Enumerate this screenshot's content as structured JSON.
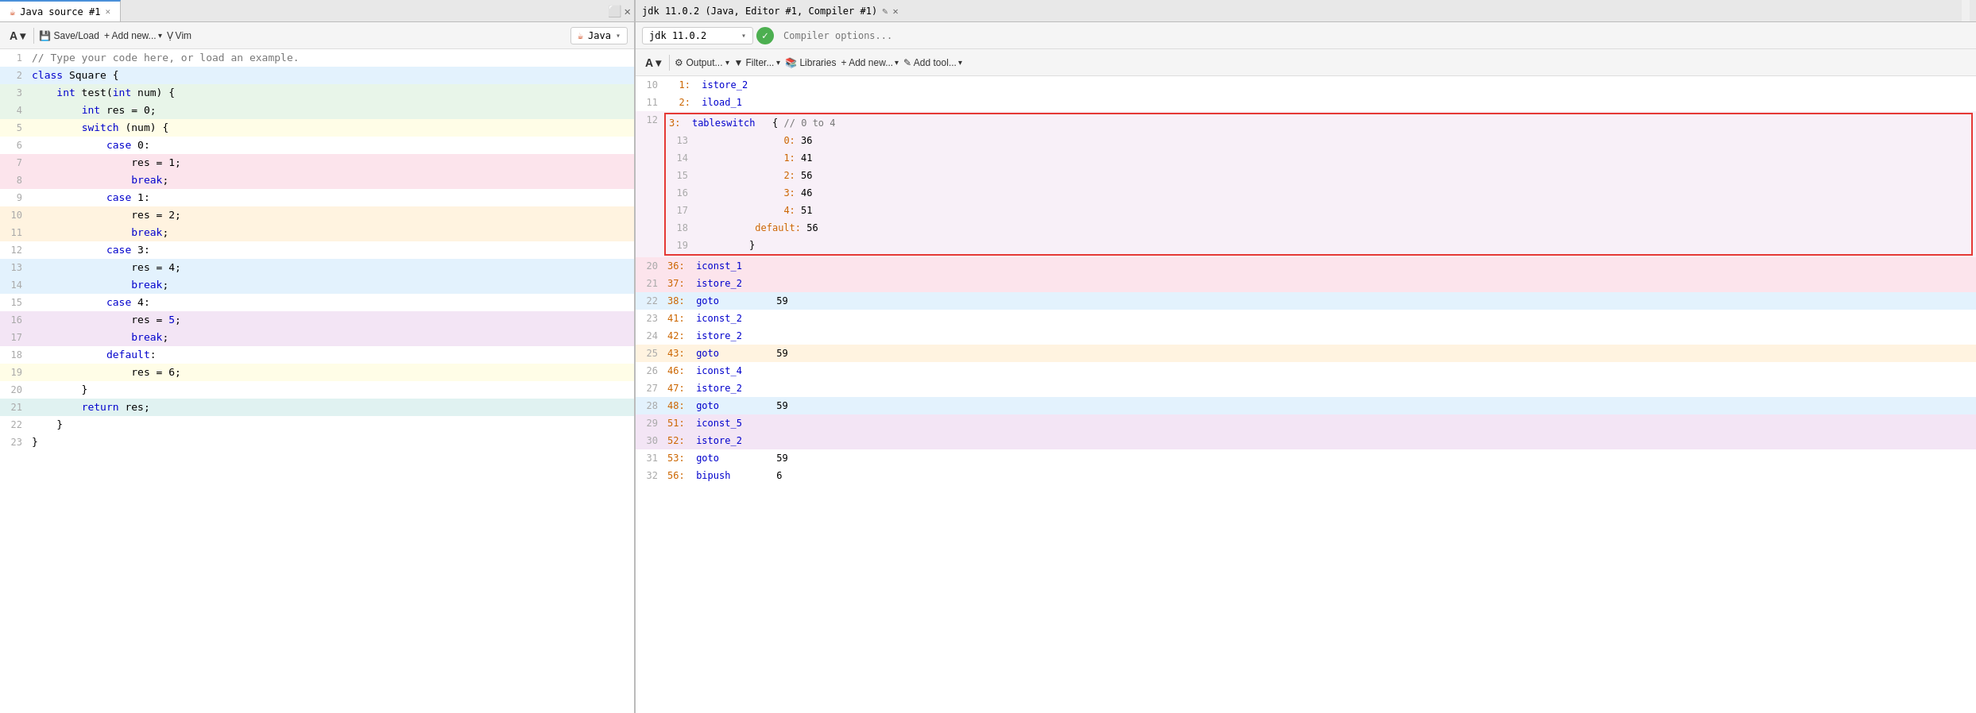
{
  "leftPane": {
    "tab": "Java source #1",
    "toolbar": {
      "font_btn": "A",
      "save_load": "Save/Load",
      "add_new": "+ Add new...",
      "vim": "Vim",
      "language": "Java"
    },
    "lines": [
      {
        "num": 1,
        "bg": "bg-white",
        "tokens": [
          {
            "t": "comment",
            "v": "// Type your code here, or load an example."
          }
        ]
      },
      {
        "num": 2,
        "bg": "bg-blue-light",
        "tokens": [
          {
            "t": "kw",
            "v": "class"
          },
          {
            "t": "plain",
            "v": " Square {"
          }
        ]
      },
      {
        "num": 3,
        "bg": "bg-green-light",
        "tokens": [
          {
            "t": "plain",
            "v": "    "
          },
          {
            "t": "type",
            "v": "int"
          },
          {
            "t": "plain",
            "v": " test("
          },
          {
            "t": "type",
            "v": "int"
          },
          {
            "t": "plain",
            "v": " num) {"
          }
        ]
      },
      {
        "num": 4,
        "bg": "bg-green-light",
        "tokens": [
          {
            "t": "plain",
            "v": "        "
          },
          {
            "t": "type",
            "v": "int"
          },
          {
            "t": "plain",
            "v": " res = 0;"
          }
        ]
      },
      {
        "num": 5,
        "bg": "bg-yellow-light",
        "tokens": [
          {
            "t": "plain",
            "v": "        "
          },
          {
            "t": "kw",
            "v": "switch"
          },
          {
            "t": "plain",
            "v": " (num) {"
          }
        ]
      },
      {
        "num": 6,
        "bg": "bg-white",
        "tokens": [
          {
            "t": "plain",
            "v": "            "
          },
          {
            "t": "kw",
            "v": "case"
          },
          {
            "t": "plain",
            "v": " 0:"
          }
        ]
      },
      {
        "num": 7,
        "bg": "bg-red-light",
        "tokens": [
          {
            "t": "plain",
            "v": "                res = 1;"
          }
        ]
      },
      {
        "num": 8,
        "bg": "bg-red-light",
        "tokens": [
          {
            "t": "plain",
            "v": "                "
          },
          {
            "t": "kw",
            "v": "break"
          },
          {
            "t": "plain",
            "v": ";"
          }
        ]
      },
      {
        "num": 9,
        "bg": "bg-white",
        "tokens": [
          {
            "t": "plain",
            "v": "            "
          },
          {
            "t": "kw",
            "v": "case"
          },
          {
            "t": "plain",
            "v": " 1:"
          }
        ]
      },
      {
        "num": 10,
        "bg": "bg-orange-light",
        "tokens": [
          {
            "t": "plain",
            "v": "                res = 2;"
          }
        ]
      },
      {
        "num": 11,
        "bg": "bg-orange-light",
        "tokens": [
          {
            "t": "plain",
            "v": "                "
          },
          {
            "t": "kw",
            "v": "break"
          },
          {
            "t": "plain",
            "v": ";"
          }
        ]
      },
      {
        "num": 12,
        "bg": "bg-white",
        "tokens": [
          {
            "t": "plain",
            "v": "            "
          },
          {
            "t": "kw",
            "v": "case"
          },
          {
            "t": "plain",
            "v": " 3:"
          }
        ]
      },
      {
        "num": 13,
        "bg": "bg-blue-light",
        "tokens": [
          {
            "t": "plain",
            "v": "                res = 4;"
          }
        ]
      },
      {
        "num": 14,
        "bg": "bg-blue-light",
        "tokens": [
          {
            "t": "plain",
            "v": "                "
          },
          {
            "t": "kw",
            "v": "break"
          },
          {
            "t": "plain",
            "v": ";"
          }
        ]
      },
      {
        "num": 15,
        "bg": "bg-white",
        "tokens": [
          {
            "t": "plain",
            "v": "            "
          },
          {
            "t": "kw",
            "v": "case"
          },
          {
            "t": "plain",
            "v": " 4:"
          }
        ]
      },
      {
        "num": 16,
        "bg": "bg-purple-light",
        "tokens": [
          {
            "t": "plain",
            "v": "                res = 5;"
          }
        ]
      },
      {
        "num": 17,
        "bg": "bg-purple-light",
        "tokens": [
          {
            "t": "plain",
            "v": "                "
          },
          {
            "t": "kw",
            "v": "break"
          },
          {
            "t": "plain",
            "v": ";"
          }
        ]
      },
      {
        "num": 18,
        "bg": "bg-white",
        "tokens": [
          {
            "t": "plain",
            "v": "            "
          },
          {
            "t": "kw",
            "v": "default"
          },
          {
            "t": "plain",
            "v": ":"
          }
        ]
      },
      {
        "num": 19,
        "bg": "bg-yellow-light",
        "tokens": [
          {
            "t": "plain",
            "v": "                res = 6;"
          }
        ]
      },
      {
        "num": 20,
        "bg": "bg-white",
        "tokens": [
          {
            "t": "plain",
            "v": "        }"
          }
        ]
      },
      {
        "num": 21,
        "bg": "bg-teal-light",
        "tokens": [
          {
            "t": "plain",
            "v": "        "
          },
          {
            "t": "kw",
            "v": "return"
          },
          {
            "t": "plain",
            "v": " res;"
          }
        ]
      },
      {
        "num": 22,
        "bg": "bg-white",
        "tokens": [
          {
            "t": "plain",
            "v": "    }"
          }
        ]
      },
      {
        "num": 23,
        "bg": "bg-white",
        "tokens": [
          {
            "t": "plain",
            "v": "}"
          }
        ]
      }
    ]
  },
  "rightPane": {
    "topbar": {
      "title": "jdk 11.0.2 (Java, Editor #1, Compiler #1)",
      "edit_icon": "✎",
      "close_icon": "✕"
    },
    "jdk_label": "jdk 11.0.2",
    "compiler_placeholder": "Compiler options...",
    "toolbar": {
      "font_btn": "A",
      "output_btn": "Output...",
      "filter_btn": "Filter...",
      "libraries_btn": "Libraries",
      "add_new_btn": "+ Add new...",
      "add_tool_btn": "✎ Add tool..."
    },
    "bytecode_lines": [
      {
        "num": 10,
        "bg": "bg-white",
        "offset": "1:",
        "instr": "istore_2",
        "arg": ""
      },
      {
        "num": 11,
        "bg": "bg-white",
        "offset": "2:",
        "instr": "iload_1",
        "arg": ""
      },
      {
        "num": 12,
        "bg": "bg-white",
        "offset": "3:",
        "instr": "tableswitch",
        "arg": "{ // 0 to 4",
        "tableswitch": true,
        "cases": [
          {
            "label": "0:",
            "val": "36"
          },
          {
            "label": "1:",
            "val": "41"
          },
          {
            "label": "2:",
            "val": "56"
          },
          {
            "label": "3:",
            "val": "46"
          },
          {
            "label": "4:",
            "val": "51"
          }
        ],
        "default": "56",
        "end_num": 18,
        "end_num19": 19
      },
      {
        "num": 20,
        "bg": "bg-red-light",
        "offset": "36:",
        "instr": "iconst_1",
        "arg": ""
      },
      {
        "num": 21,
        "bg": "bg-red-light",
        "offset": "37:",
        "instr": "istore_2",
        "arg": ""
      },
      {
        "num": 22,
        "bg": "bg-blue-light",
        "offset": "38:",
        "instr": "goto",
        "arg": "59"
      },
      {
        "num": 23,
        "bg": "bg-white",
        "offset": "41:",
        "instr": "iconst_2",
        "arg": ""
      },
      {
        "num": 24,
        "bg": "bg-white",
        "offset": "42:",
        "instr": "istore_2",
        "arg": ""
      },
      {
        "num": 25,
        "bg": "bg-orange-light",
        "offset": "43:",
        "instr": "goto",
        "arg": "59"
      },
      {
        "num": 26,
        "bg": "bg-white",
        "offset": "46:",
        "instr": "iconst_4",
        "arg": ""
      },
      {
        "num": 27,
        "bg": "bg-white",
        "offset": "47:",
        "instr": "istore_2",
        "arg": ""
      },
      {
        "num": 28,
        "bg": "bg-blue-light",
        "offset": "48:",
        "instr": "goto",
        "arg": "59"
      },
      {
        "num": 29,
        "bg": "bg-purple-light",
        "offset": "51:",
        "instr": "iconst_5",
        "arg": ""
      },
      {
        "num": 30,
        "bg": "bg-purple-light",
        "offset": "52:",
        "instr": "istore_2",
        "arg": ""
      },
      {
        "num": 31,
        "bg": "bg-white",
        "offset": "53:",
        "instr": "goto",
        "arg": "59"
      },
      {
        "num": 32,
        "bg": "bg-white",
        "offset": "56:",
        "instr": "bipush",
        "arg": "6"
      }
    ]
  }
}
